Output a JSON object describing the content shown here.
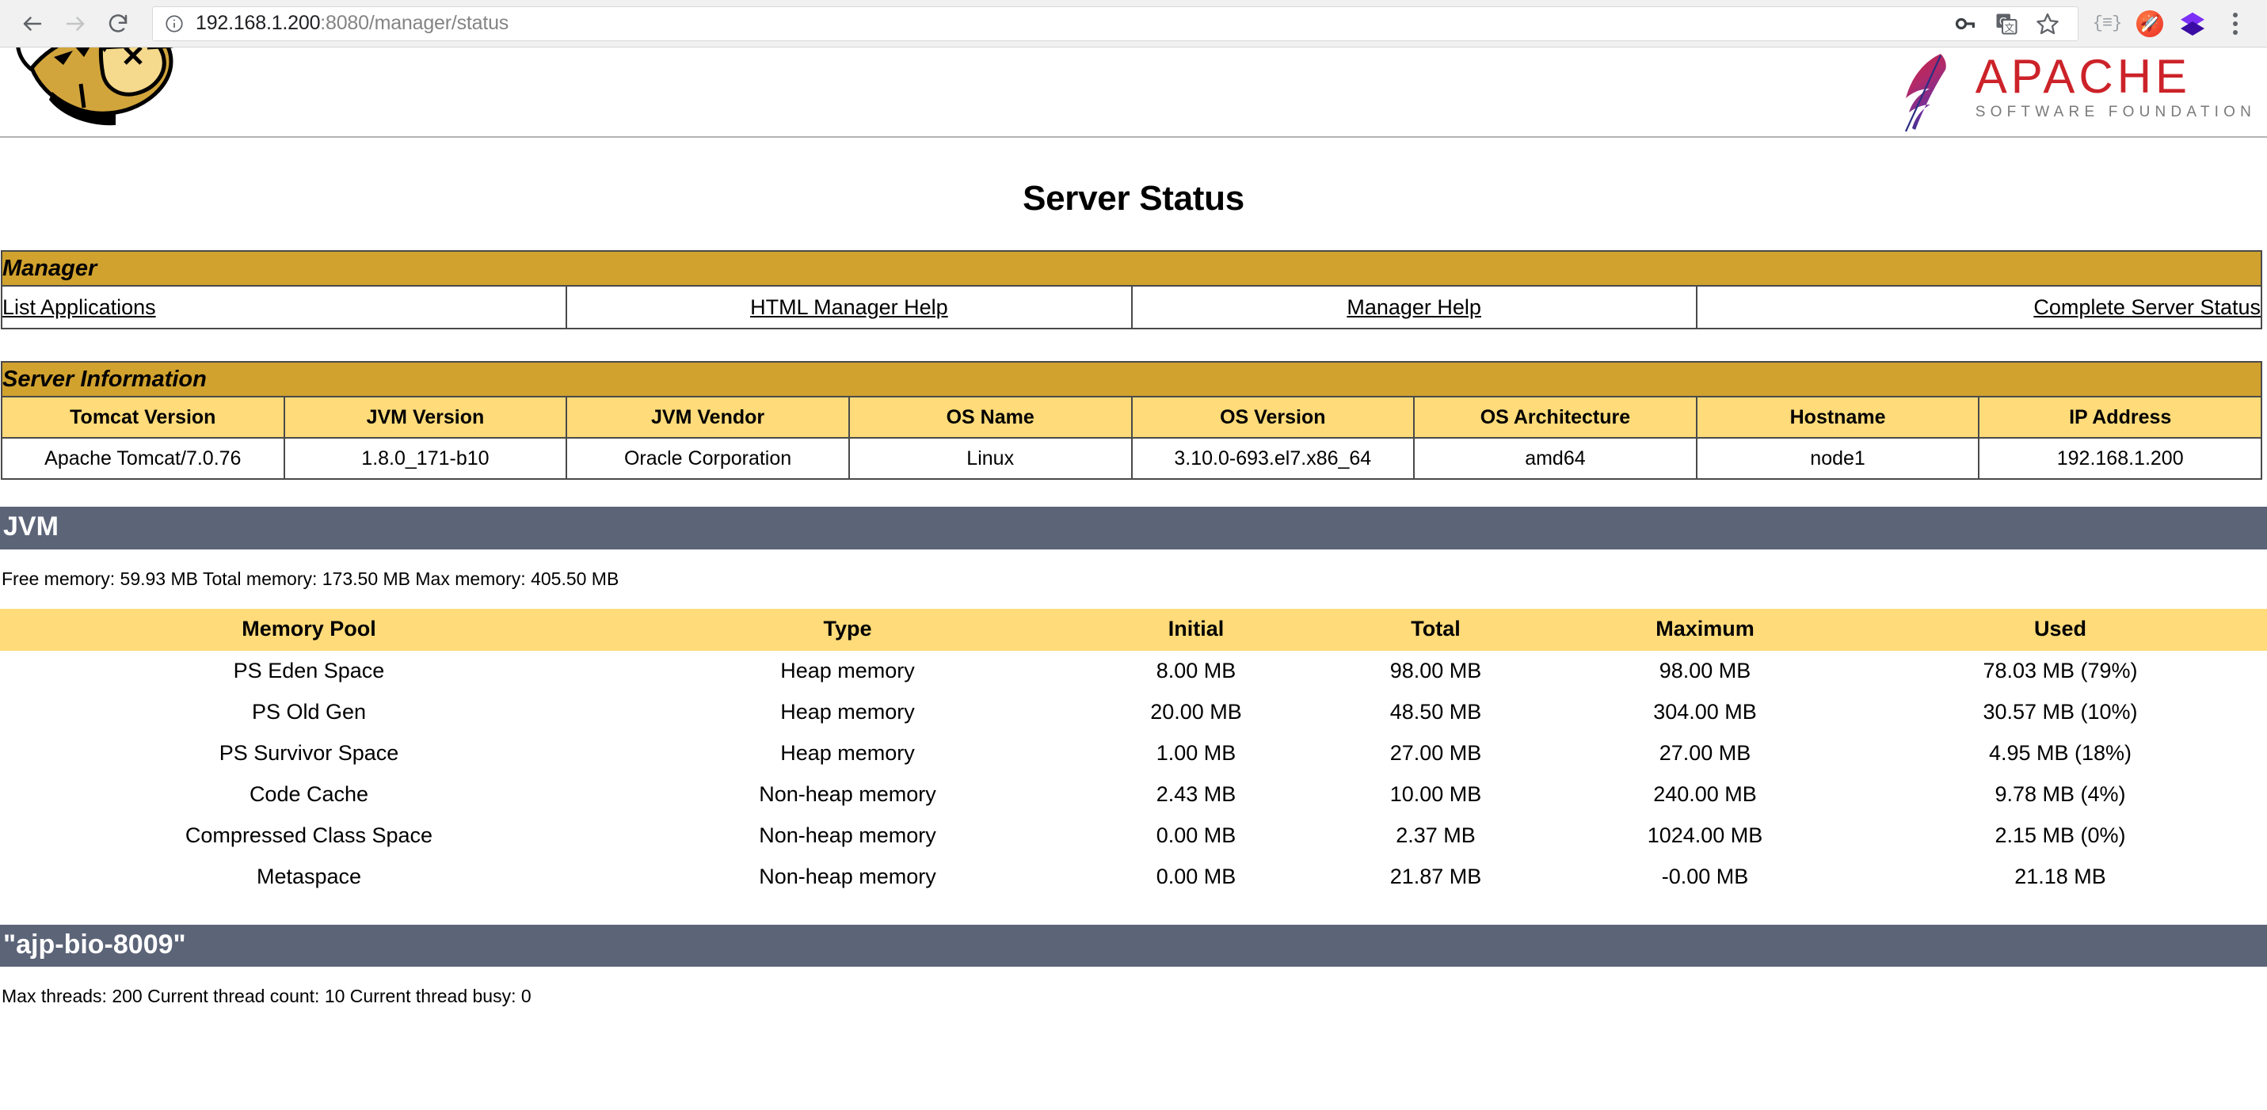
{
  "browser": {
    "back_icon": "back-arrow-icon",
    "forward_icon": "forward-arrow-icon",
    "reload_icon": "reload-icon",
    "info_icon": "info-circle-icon",
    "url_host": "192.168.1.200",
    "url_rest": ":8080/manager/status",
    "url_full": "192.168.1.200:8080/manager/status",
    "omni_icons": [
      "key-icon",
      "translate-icon",
      "star-bookmark-icon"
    ],
    "ext_icons": [
      "code-braces-icon",
      "rocket-blocker-icon",
      "layers-diamond-icon",
      "three-dot-menu-icon"
    ],
    "ext_code_glyph": "{≡}"
  },
  "masthead": {
    "logo_left": "tomcat-cat-logo",
    "apache_word": "APACHE",
    "apache_sub": "SOFTWARE FOUNDATION"
  },
  "page": {
    "title": "Server Status"
  },
  "manager": {
    "section_label": "Manager",
    "links": [
      {
        "label": "List Applications",
        "align": "al-left"
      },
      {
        "label": "HTML Manager Help",
        "align": "al-center"
      },
      {
        "label": "Manager Help",
        "align": "al-center"
      },
      {
        "label": "Complete Server Status",
        "align": "al-right"
      }
    ]
  },
  "server_info": {
    "section_label": "Server Information",
    "headers": [
      "Tomcat Version",
      "JVM Version",
      "JVM Vendor",
      "OS Name",
      "OS Version",
      "OS Architecture",
      "Hostname",
      "IP Address"
    ],
    "row": [
      "Apache Tomcat/7.0.76",
      "1.8.0_171-b10",
      "Oracle Corporation",
      "Linux",
      "3.10.0-693.el7.x86_64",
      "amd64",
      "node1",
      "192.168.1.200"
    ]
  },
  "jvm": {
    "banner": "JVM",
    "memory_line": "Free memory: 59.93 MB Total memory: 173.50 MB Max memory: 405.50 MB",
    "free_memory": "59.93 MB",
    "total_memory": "173.50 MB",
    "max_memory": "405.50 MB",
    "table": {
      "headers": [
        "Memory Pool",
        "Type",
        "Initial",
        "Total",
        "Maximum",
        "Used"
      ],
      "rows": [
        [
          "PS Eden Space",
          "Heap memory",
          "8.00 MB",
          "98.00 MB",
          "98.00 MB",
          "78.03 MB (79%)"
        ],
        [
          "PS Old Gen",
          "Heap memory",
          "20.00 MB",
          "48.50 MB",
          "304.00 MB",
          "30.57 MB (10%)"
        ],
        [
          "PS Survivor Space",
          "Heap memory",
          "1.00 MB",
          "27.00 MB",
          "27.00 MB",
          "4.95 MB (18%)"
        ],
        [
          "Code Cache",
          "Non-heap memory",
          "2.43 MB",
          "10.00 MB",
          "240.00 MB",
          "9.78 MB (4%)"
        ],
        [
          "Compressed Class Space",
          "Non-heap memory",
          "0.00 MB",
          "2.37 MB",
          "1024.00 MB",
          "2.15 MB (0%)"
        ],
        [
          "Metaspace",
          "Non-heap memory",
          "0.00 MB",
          "21.87 MB",
          "-0.00 MB",
          "21.18 MB"
        ]
      ]
    }
  },
  "connector": {
    "banner": "\"ajp-bio-8009\"",
    "threads_line": "Max threads: 200 Current thread count: 10 Current thread busy: 0",
    "max_threads": "200",
    "current_thread_count": "10",
    "current_thread_busy": "0"
  },
  "colors": {
    "section_gold": "#D1A22E",
    "header_gold": "#FFDB79",
    "banner_slate": "#5C6478",
    "apache_red": "#CC2229",
    "link_black": "#000000"
  }
}
